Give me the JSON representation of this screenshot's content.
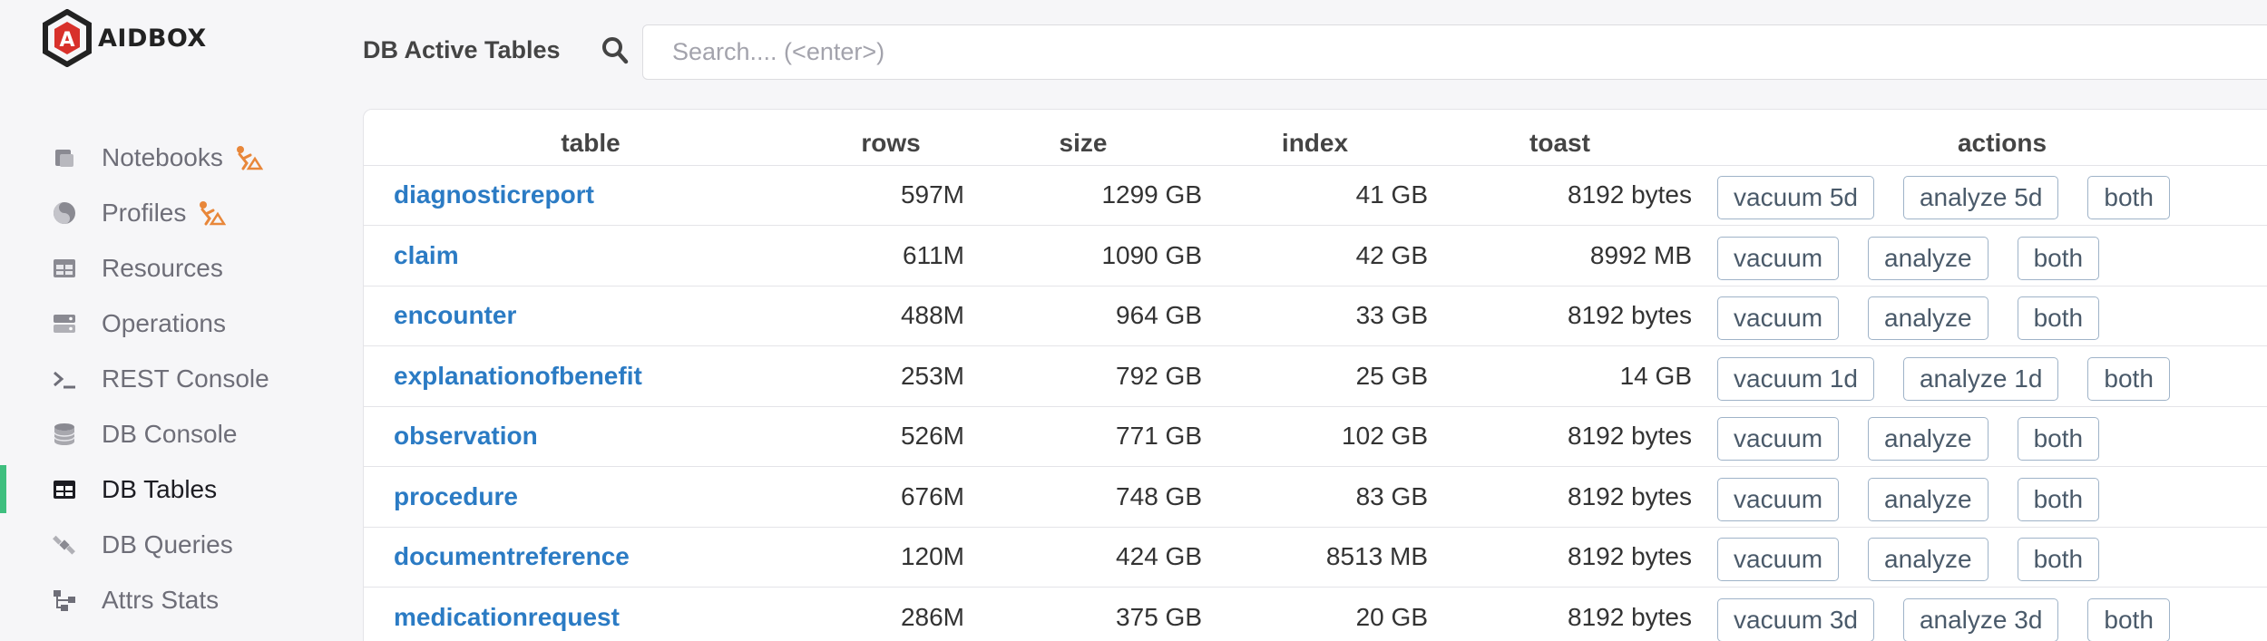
{
  "brand": {
    "name": "AIDBOX"
  },
  "nav": {
    "items": [
      {
        "label": "Notebooks",
        "icon": "scroll-icon",
        "badge": "construction-icon",
        "active": false
      },
      {
        "label": "Profiles",
        "icon": "yin-yang-icon",
        "badge": "construction-icon",
        "active": false
      },
      {
        "label": "Resources",
        "icon": "table-icon",
        "active": false
      },
      {
        "label": "Operations",
        "icon": "server-icon",
        "active": false
      },
      {
        "label": "REST Console",
        "icon": "terminal-icon",
        "active": false
      },
      {
        "label": "DB Console",
        "icon": "database-icon",
        "active": false
      },
      {
        "label": "DB Tables",
        "icon": "table-icon",
        "active": true
      },
      {
        "label": "DB Queries",
        "icon": "satellite-icon",
        "active": false
      },
      {
        "label": "Attrs Stats",
        "icon": "diagram-icon",
        "active": false
      }
    ]
  },
  "header": {
    "title": "DB Active Tables",
    "search_placeholder": "Search.... (<enter>)"
  },
  "colors": {
    "link": "#2b7bc4",
    "active_marker": "#3fbf7f",
    "badge": "#e8873a"
  },
  "table": {
    "headers": {
      "table": "table",
      "rows": "rows",
      "size": "size",
      "index": "index",
      "toast": "toast",
      "actions": "actions"
    },
    "rows": [
      {
        "name": "diagnosticreport",
        "rows": "597M",
        "size": "1299 GB",
        "index": "41 GB",
        "toast": "8192 bytes",
        "actions": [
          "vacuum 5d",
          "analyze 5d",
          "both"
        ]
      },
      {
        "name": "claim",
        "rows": "611M",
        "size": "1090 GB",
        "index": "42 GB",
        "toast": "8992 MB",
        "actions": [
          "vacuum",
          "analyze",
          "both"
        ]
      },
      {
        "name": "encounter",
        "rows": "488M",
        "size": "964 GB",
        "index": "33 GB",
        "toast": "8192 bytes",
        "actions": [
          "vacuum",
          "analyze",
          "both"
        ]
      },
      {
        "name": "explanationofbenefit",
        "rows": "253M",
        "size": "792 GB",
        "index": "25 GB",
        "toast": "14 GB",
        "actions": [
          "vacuum 1d",
          "analyze 1d",
          "both"
        ]
      },
      {
        "name": "observation",
        "rows": "526M",
        "size": "771 GB",
        "index": "102 GB",
        "toast": "8192 bytes",
        "actions": [
          "vacuum",
          "analyze",
          "both"
        ]
      },
      {
        "name": "procedure",
        "rows": "676M",
        "size": "748 GB",
        "index": "83 GB",
        "toast": "8192 bytes",
        "actions": [
          "vacuum",
          "analyze",
          "both"
        ]
      },
      {
        "name": "documentreference",
        "rows": "120M",
        "size": "424 GB",
        "index": "8513 MB",
        "toast": "8192 bytes",
        "actions": [
          "vacuum",
          "analyze",
          "both"
        ]
      },
      {
        "name": "medicationrequest",
        "rows": "286M",
        "size": "375 GB",
        "index": "20 GB",
        "toast": "8192 bytes",
        "actions": [
          "vacuum 3d",
          "analyze 3d",
          "both"
        ]
      }
    ]
  }
}
